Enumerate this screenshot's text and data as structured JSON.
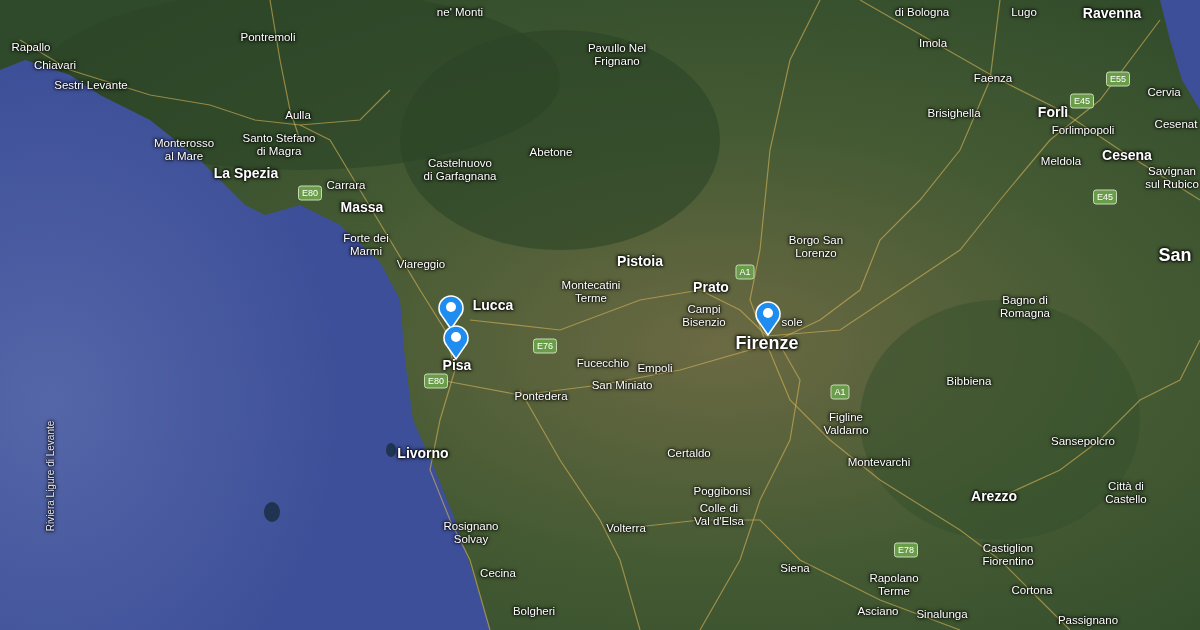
{
  "map": {
    "labels": [
      {
        "text": "ne' Monti",
        "kind": "town"
      },
      {
        "text": "di Bologna",
        "kind": "town"
      },
      {
        "text": "Lugo",
        "kind": "town"
      },
      {
        "text": "Ravenna",
        "kind": "city"
      },
      {
        "text": "Rapallo",
        "kind": "town"
      },
      {
        "text": "Pontremoli",
        "kind": "town"
      },
      {
        "text": "Pavullo Nel\nFrignano",
        "kind": "town"
      },
      {
        "text": "Imola",
        "kind": "town"
      },
      {
        "text": "Chiavari",
        "kind": "town"
      },
      {
        "text": "Sestri Levante",
        "kind": "town"
      },
      {
        "text": "Aulla",
        "kind": "town"
      },
      {
        "text": "Faenza",
        "kind": "town"
      },
      {
        "text": "Cervia",
        "kind": "town"
      },
      {
        "text": "Brisighella",
        "kind": "town"
      },
      {
        "text": "Forlì",
        "kind": "city"
      },
      {
        "text": "Forlimpopoli",
        "kind": "town"
      },
      {
        "text": "Cesenat",
        "kind": "town"
      },
      {
        "text": "Monterosso\nal Mare",
        "kind": "town"
      },
      {
        "text": "Santo Stefano\ndi Magra",
        "kind": "town"
      },
      {
        "text": "Abetone",
        "kind": "town"
      },
      {
        "text": "Cesena",
        "kind": "city"
      },
      {
        "text": "Meldola",
        "kind": "town"
      },
      {
        "text": "La Spezia",
        "kind": "city"
      },
      {
        "text": "Castelnuovo\ndi Garfagnana",
        "kind": "town"
      },
      {
        "text": "Carrara",
        "kind": "town"
      },
      {
        "text": "Savignan\nsul Rubico",
        "kind": "town"
      },
      {
        "text": "Massa",
        "kind": "city"
      },
      {
        "text": "Forte dei\nMarmi",
        "kind": "town"
      },
      {
        "text": "Borgo San\nLorenzo",
        "kind": "town"
      },
      {
        "text": "San",
        "kind": "capital"
      },
      {
        "text": "Pistoia",
        "kind": "city"
      },
      {
        "text": "Viareggio",
        "kind": "town"
      },
      {
        "text": "Montecatini\nTerme",
        "kind": "town"
      },
      {
        "text": "Prato",
        "kind": "city"
      },
      {
        "text": "Lucca",
        "kind": "city"
      },
      {
        "text": "Bagno di\nRomagna",
        "kind": "town"
      },
      {
        "text": "Campi\nBisenzio",
        "kind": "town"
      },
      {
        "text": "sole",
        "kind": "town"
      },
      {
        "text": "Firenze",
        "kind": "capital"
      },
      {
        "text": "Pisa",
        "kind": "city"
      },
      {
        "text": "Fucecchio",
        "kind": "town"
      },
      {
        "text": "Empoli",
        "kind": "town"
      },
      {
        "text": "San Miniato",
        "kind": "town"
      },
      {
        "text": "Pontedera",
        "kind": "town"
      },
      {
        "text": "Bibbiena",
        "kind": "town"
      },
      {
        "text": "Figline\nValdarno",
        "kind": "town"
      },
      {
        "text": "Sansepolcro",
        "kind": "town"
      },
      {
        "text": "Livorno",
        "kind": "city"
      },
      {
        "text": "Certaldo",
        "kind": "town"
      },
      {
        "text": "Montevarchi",
        "kind": "town"
      },
      {
        "text": "Riviera Ligure di Levante",
        "kind": "sea"
      },
      {
        "text": "Poggibonsi",
        "kind": "town"
      },
      {
        "text": "Arezzo",
        "kind": "city"
      },
      {
        "text": "Città di\nCastello",
        "kind": "town"
      },
      {
        "text": "Colle di\nVal d'Elsa",
        "kind": "town"
      },
      {
        "text": "Volterra",
        "kind": "town"
      },
      {
        "text": "Rosignano\nSolvay",
        "kind": "town"
      },
      {
        "text": "Castiglion\nFiorentino",
        "kind": "town"
      },
      {
        "text": "Siena",
        "kind": "town"
      },
      {
        "text": "Cecina",
        "kind": "town"
      },
      {
        "text": "Rapolano\nTerme",
        "kind": "town"
      },
      {
        "text": "Cortona",
        "kind": "town"
      },
      {
        "text": "Bolgheri",
        "kind": "town"
      },
      {
        "text": "Asciano",
        "kind": "town"
      },
      {
        "text": "Sinalunga",
        "kind": "town"
      },
      {
        "text": "Passignano",
        "kind": "town"
      }
    ],
    "road_shields": [
      {
        "text": "E80"
      },
      {
        "text": "E55"
      },
      {
        "text": "E45"
      },
      {
        "text": "E45"
      },
      {
        "text": "A1"
      },
      {
        "text": "E76"
      },
      {
        "text": "A1"
      },
      {
        "text": "E80"
      },
      {
        "text": "E78"
      }
    ]
  }
}
